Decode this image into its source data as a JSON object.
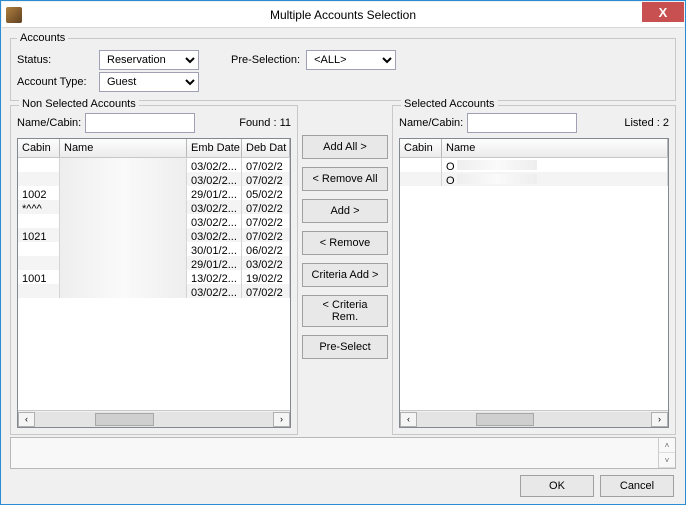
{
  "window": {
    "title": "Multiple Accounts Selection",
    "close": "X"
  },
  "accounts": {
    "legend": "Accounts",
    "status_label": "Status:",
    "status_value": "Reservation",
    "presel_label": "Pre-Selection:",
    "presel_value": "<ALL>",
    "acct_type_label": "Account Type:",
    "acct_type_value": "Guest"
  },
  "left": {
    "title": "Non Selected Accounts",
    "search_label": "Name/Cabin:",
    "search_value": "",
    "found_label": "Found : 11",
    "cols": {
      "cabin": "Cabin",
      "name": "Name",
      "emb": "Emb Date",
      "deb": "Deb Dat"
    },
    "rows": [
      {
        "cabin": "",
        "emb": "03/02/2...",
        "deb": "07/02/2"
      },
      {
        "cabin": "",
        "emb": "03/02/2...",
        "deb": "07/02/2"
      },
      {
        "cabin": "1002",
        "emb": "29/01/2...",
        "deb": "05/02/2"
      },
      {
        "cabin": "*^^^",
        "emb": "03/02/2...",
        "deb": "07/02/2"
      },
      {
        "cabin": "",
        "emb": "03/02/2...",
        "deb": "07/02/2"
      },
      {
        "cabin": "1021",
        "emb": "03/02/2...",
        "deb": "07/02/2"
      },
      {
        "cabin": "",
        "emb": "30/01/2...",
        "deb": "06/02/2"
      },
      {
        "cabin": "",
        "emb": "29/01/2...",
        "deb": "03/02/2"
      },
      {
        "cabin": "1001",
        "emb": "13/02/2...",
        "deb": "19/02/2"
      },
      {
        "cabin": "",
        "emb": "03/02/2...",
        "deb": "07/02/2"
      }
    ]
  },
  "mid": {
    "add_all": "Add All >",
    "remove_all": "< Remove All",
    "add": "Add >",
    "remove": "< Remove",
    "criteria_add": "Criteria Add >",
    "criteria_rem": "< Criteria Rem.",
    "preselect": "Pre-Select"
  },
  "right": {
    "title": "Selected Accounts",
    "search_label": "Name/Cabin:",
    "search_value": "",
    "listed_label": "Listed : 2",
    "cols": {
      "cabin": "Cabin",
      "name": "Name"
    },
    "rows": [
      {
        "cabin": "",
        "name": "O"
      },
      {
        "cabin": "",
        "name": "O"
      }
    ]
  },
  "footer": {
    "ok": "OK",
    "cancel": "Cancel"
  },
  "scroll": {
    "left": "‹",
    "right": "›",
    "up": "˄",
    "down": "˅"
  }
}
